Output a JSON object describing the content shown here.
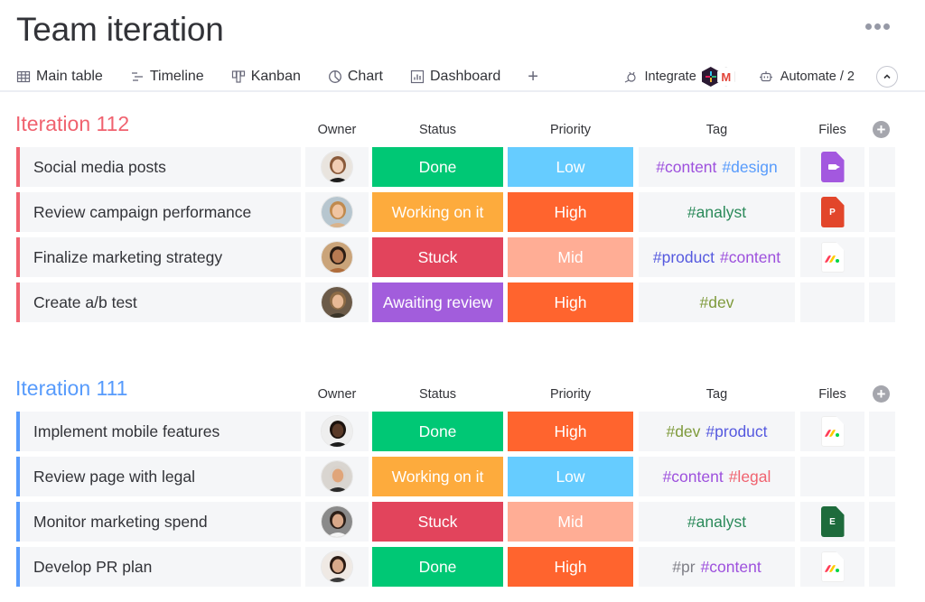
{
  "header": {
    "title": "Team iteration",
    "more_icon": "ellipsis-icon"
  },
  "tabs": [
    {
      "label": "Main table",
      "icon": "table-icon",
      "active": true
    },
    {
      "label": "Timeline",
      "icon": "timeline-icon",
      "active": false
    },
    {
      "label": "Kanban",
      "icon": "kanban-icon",
      "active": false
    },
    {
      "label": "Chart",
      "icon": "chart-pie-icon",
      "active": false
    },
    {
      "label": "Dashboard",
      "icon": "dashboard-icon",
      "active": false
    }
  ],
  "add_view_label": "+",
  "tools": {
    "integrate_label": "Integrate",
    "integrate_logos": [
      "slack-logo",
      "gmail-logo"
    ],
    "gmail_glyph": "M",
    "automate_label": "Automate / 2",
    "collapse_glyph": "^"
  },
  "columns": {
    "owner": "Owner",
    "status": "Status",
    "priority": "Priority",
    "tag": "Tag",
    "files": "Files",
    "add_column": "+"
  },
  "colors": {
    "done": "#00c875",
    "working": "#fdab3d",
    "stuck": "#e2445c",
    "awaiting": "#a25ddc",
    "low": "#66ccff",
    "high": "#ff642e",
    "mid": "#ffad95",
    "group1": "#f0626f",
    "group2": "#579bfc"
  },
  "groups": [
    {
      "title": "Iteration 112",
      "color": "#f0626f",
      "rows": [
        {
          "item": "Social media posts",
          "owner": "avatar-woman-1",
          "status": "Done",
          "status_color": "#00c875",
          "priority": "Low",
          "priority_color": "#66ccff",
          "tags": [
            {
              "text": "#content",
              "color": "#9d50dd"
            },
            {
              "text": "#design",
              "color": "#579bfc"
            }
          ],
          "file": "video"
        },
        {
          "item": "Review campaign performance",
          "owner": "avatar-woman-2",
          "status": "Working on it",
          "status_color": "#fdab3d",
          "priority": "High",
          "priority_color": "#ff642e",
          "tags": [
            {
              "text": "#analyst",
              "color": "#2b8a5a"
            }
          ],
          "file": "ppt"
        },
        {
          "item": "Finalize marketing strategy",
          "owner": "avatar-man-1",
          "status": "Stuck",
          "status_color": "#e2445c",
          "priority": "Mid",
          "priority_color": "#ffad95",
          "tags": [
            {
              "text": "#product",
              "color": "#5559df"
            },
            {
              "text": "#content",
              "color": "#9d50dd"
            }
          ],
          "file": "monday"
        },
        {
          "item": "Create a/b test",
          "owner": "avatar-woman-3",
          "status": "Awaiting review",
          "status_color": "#a25ddc",
          "priority": "High",
          "priority_color": "#ff642e",
          "tags": [
            {
              "text": "#dev",
              "color": "#7e9a3b"
            }
          ],
          "file": ""
        }
      ]
    },
    {
      "title": "Iteration 111",
      "color": "#579bfc",
      "rows": [
        {
          "item": "Implement mobile features",
          "owner": "avatar-man-2",
          "status": "Done",
          "status_color": "#00c875",
          "priority": "High",
          "priority_color": "#ff642e",
          "tags": [
            {
              "text": "#dev",
              "color": "#7e9a3b"
            },
            {
              "text": "#product",
              "color": "#5559df"
            }
          ],
          "file": "monday"
        },
        {
          "item": "Review page with legal",
          "owner": "avatar-man-3",
          "status": "Working on it",
          "status_color": "#fdab3d",
          "priority": "Low",
          "priority_color": "#66ccff",
          "tags": [
            {
              "text": "#content",
              "color": "#9d50dd"
            },
            {
              "text": "#legal",
              "color": "#f0626f"
            }
          ],
          "file": ""
        },
        {
          "item": "Monitor marketing spend",
          "owner": "avatar-woman-4",
          "status": "Stuck",
          "status_color": "#e2445c",
          "priority": "Mid",
          "priority_color": "#ffad95",
          "tags": [
            {
              "text": "#analyst",
              "color": "#2b8a5a"
            }
          ],
          "file": "xls"
        },
        {
          "item": "Develop PR plan",
          "owner": "avatar-woman-5",
          "status": "Done",
          "status_color": "#00c875",
          "priority": "High",
          "priority_color": "#ff642e",
          "tags": [
            {
              "text": "#pr",
              "color": "#7f7f87"
            },
            {
              "text": "#content",
              "color": "#9d50dd"
            }
          ],
          "file": "monday"
        }
      ]
    }
  ],
  "file_labels": {
    "ppt": "P",
    "xls": "E"
  }
}
